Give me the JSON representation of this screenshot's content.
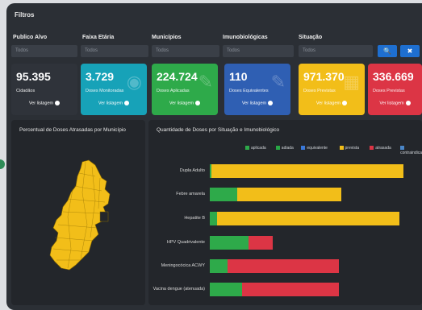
{
  "header": {
    "title": "Filtros"
  },
  "filters": [
    {
      "label": "Publico Alvo",
      "placeholder": "Todos"
    },
    {
      "label": "Faixa Etária",
      "placeholder": "Todos"
    },
    {
      "label": "Municípios",
      "placeholder": "Todos"
    },
    {
      "label": "Imunobiológicas",
      "placeholder": "Todos"
    },
    {
      "label": "Situação",
      "placeholder": "Todos"
    }
  ],
  "filter_buttons": {
    "search_icon": "search-icon",
    "clear_icon": "clear-filter-icon",
    "search_glyph": "🔍",
    "clear_glyph": "✖"
  },
  "cards": [
    {
      "value": "95.395",
      "label": "Cidadãos",
      "button": "Ver listagem",
      "color": "#2f333a",
      "icon": "people-icon"
    },
    {
      "value": "3.729",
      "label": "Doses Monitoradas",
      "button": "Ver listagem",
      "color": "#17a2b8",
      "icon": "eye-icon"
    },
    {
      "value": "224.724",
      "label": "Doses Aplicadas",
      "button": "Ver listagem",
      "color": "#2eaa4a",
      "icon": "syringe-icon"
    },
    {
      "value": "110",
      "label": "Doses Equivalentes",
      "button": "Ver listagem",
      "color": "#2f5fb3",
      "icon": "syringe-icon"
    },
    {
      "value": "971.370",
      "label": "Doses Previstas",
      "button": "Ver listagem",
      "color": "#f2be19",
      "icon": "calendar-icon"
    },
    {
      "value": "336.669",
      "label": "Doses Previstas",
      "button": "Ver listagem",
      "color": "#dc3545",
      "icon": "warning-icon"
    }
  ],
  "map_panel": {
    "title": "Percentual de Doses Atrasadas por Município"
  },
  "chart_panel": {
    "title": "Quantidade de Doses por Situação e Imunobiológico"
  },
  "chart_data": {
    "type": "bar",
    "orientation": "horizontal",
    "stacked": true,
    "categories": [
      "Dupla Adulto",
      "Febre amarela",
      "Hepatite B",
      "HPV Quadrivalente",
      "Meningocócica ACWY",
      "Vacina dengue (atenuada)"
    ],
    "series": [
      {
        "name": "aplicada",
        "color": "#2eaa4a",
        "values": [
          2,
          34,
          9,
          48,
          22,
          40
        ]
      },
      {
        "name": "adiada",
        "color": "#28a745",
        "values": [
          0,
          0,
          0,
          0,
          0,
          0
        ]
      },
      {
        "name": "equivalente",
        "color": "#3a78d8",
        "values": [
          0,
          0,
          0,
          0,
          0,
          0
        ]
      },
      {
        "name": "prevista",
        "color": "#f2be19",
        "values": [
          238,
          129,
          226,
          0,
          0,
          0
        ]
      },
      {
        "name": "atrasada",
        "color": "#dc3545",
        "values": [
          0,
          0,
          0,
          30,
          138,
          120
        ]
      },
      {
        "name": "contraindicada",
        "color": "#4a86c8",
        "values": [
          0,
          0,
          0,
          0,
          0,
          0
        ]
      }
    ],
    "legend": [
      "aplicada",
      "adiada",
      "equivalente",
      "prevista",
      "atrasada",
      "contraindicada"
    ],
    "legend_colors": [
      "#2eaa4a",
      "#28a745",
      "#3a78d8",
      "#f2be19",
      "#dc3545",
      "#4a86c8"
    ],
    "grid": false,
    "legend_position": "top"
  }
}
